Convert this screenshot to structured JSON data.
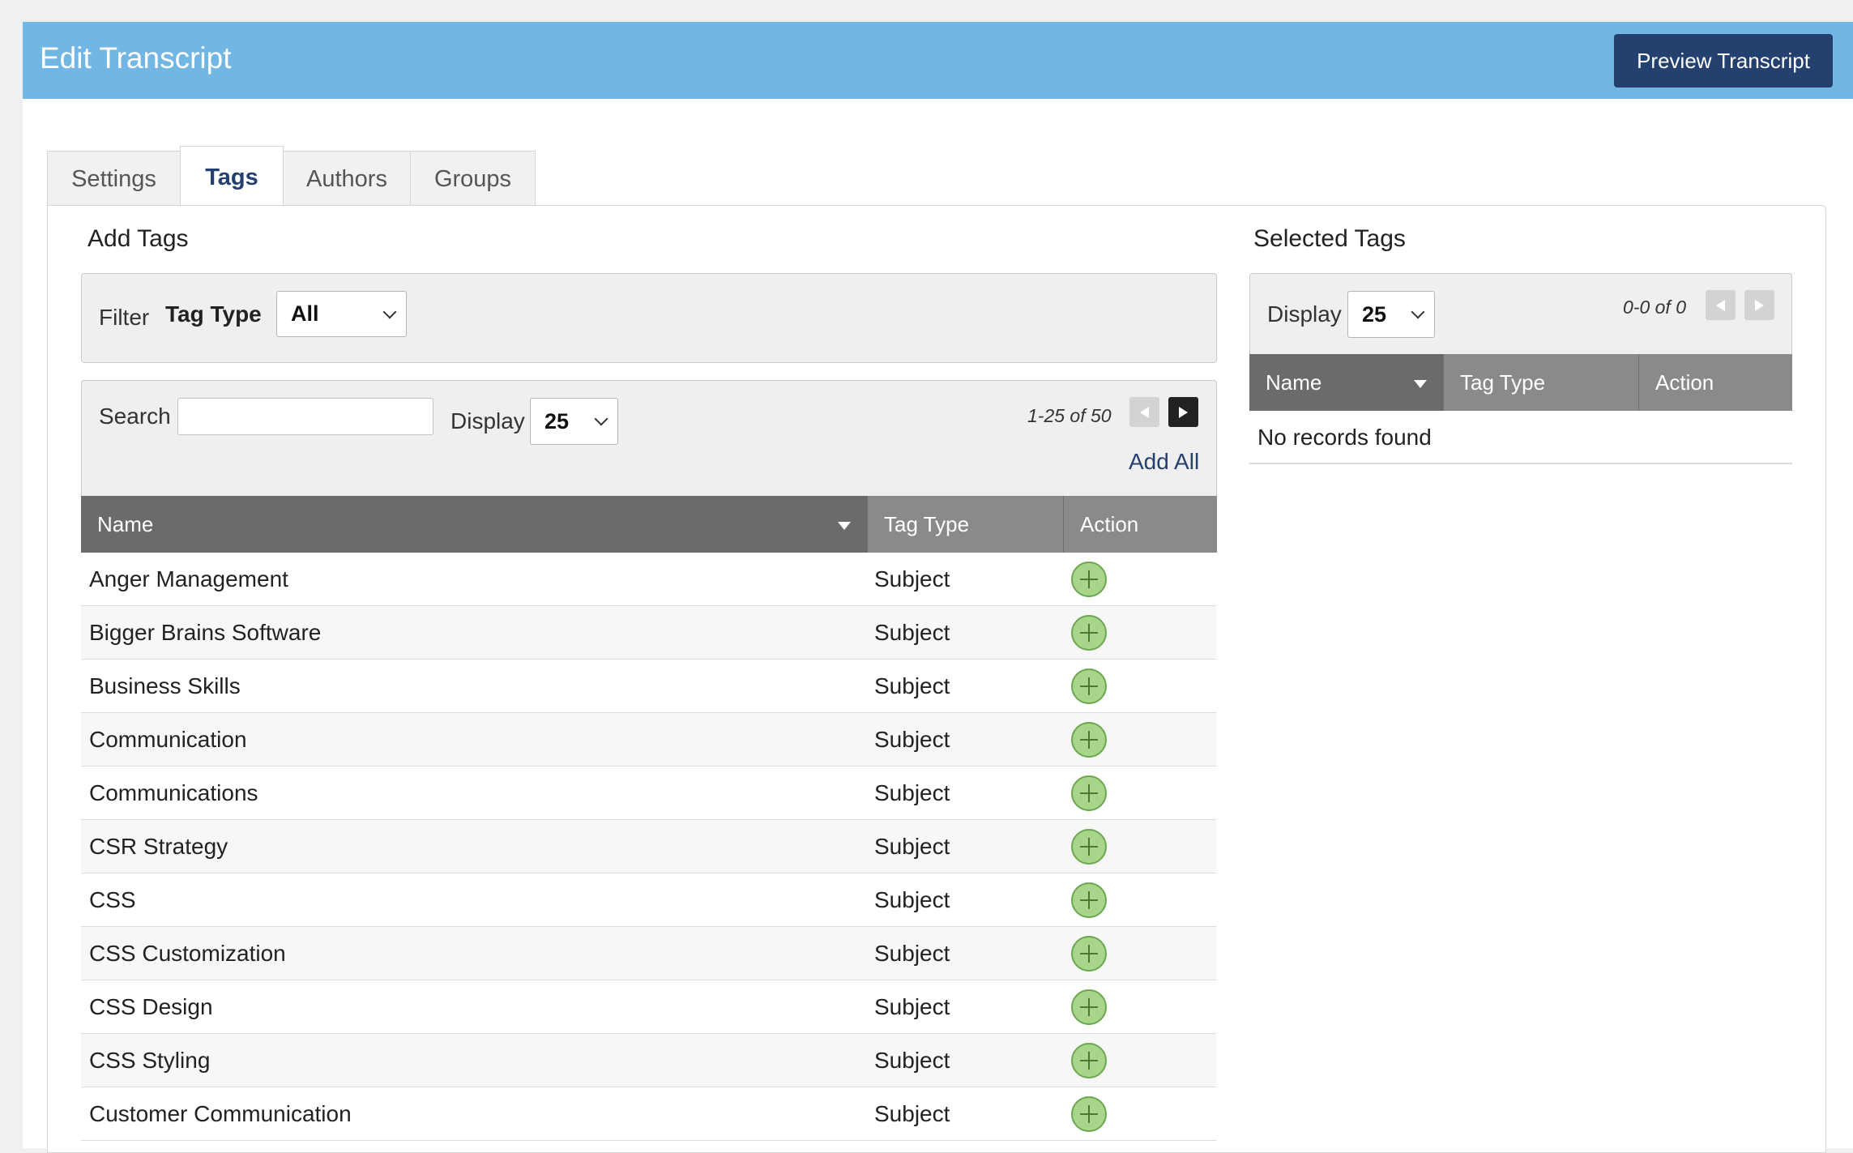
{
  "header": {
    "title": "Edit Transcript",
    "preview_label": "Preview Transcript"
  },
  "tabs": [
    {
      "label": "Settings",
      "active": false
    },
    {
      "label": "Tags",
      "active": true
    },
    {
      "label": "Authors",
      "active": false
    },
    {
      "label": "Groups",
      "active": false
    }
  ],
  "add_tags": {
    "title": "Add Tags",
    "filter": {
      "label": "Filter",
      "tag_type_label": "Tag Type",
      "tag_type_value": "All"
    },
    "search": {
      "label": "Search",
      "value": "",
      "placeholder": ""
    },
    "display": {
      "label": "Display",
      "value": "25"
    },
    "pager": {
      "text": "1-25 of 50"
    },
    "add_all_label": "Add All",
    "columns": {
      "name": "Name",
      "tag_type": "Tag Type",
      "action": "Action"
    },
    "rows": [
      {
        "name": "Anger Management",
        "tag_type": "Subject"
      },
      {
        "name": "Bigger Brains Software",
        "tag_type": "Subject"
      },
      {
        "name": "Business Skills",
        "tag_type": "Subject"
      },
      {
        "name": "Communication",
        "tag_type": "Subject"
      },
      {
        "name": "Communications",
        "tag_type": "Subject"
      },
      {
        "name": "CSR Strategy",
        "tag_type": "Subject"
      },
      {
        "name": "CSS",
        "tag_type": "Subject"
      },
      {
        "name": "CSS Customization",
        "tag_type": "Subject"
      },
      {
        "name": "CSS Design",
        "tag_type": "Subject"
      },
      {
        "name": "CSS Styling",
        "tag_type": "Subject"
      },
      {
        "name": "Customer Communication",
        "tag_type": "Subject"
      }
    ]
  },
  "selected_tags": {
    "title": "Selected Tags",
    "display": {
      "label": "Display",
      "value": "25"
    },
    "pager": {
      "text": "0-0 of 0"
    },
    "columns": {
      "name": "Name",
      "tag_type": "Tag Type",
      "action": "Action"
    },
    "empty_text": "No records found"
  },
  "colors": {
    "header_bg": "#72b6e3",
    "primary_button": "#23406e",
    "table_header_sorted": "#6b6b6b",
    "table_header": "#8a8a8a",
    "add_icon": "#a9d58b"
  },
  "icons": {
    "add": "plus-circle-icon",
    "sort": "sort-down-icon",
    "prev": "prev-page-icon",
    "next": "next-page-icon",
    "select": "chevron-down-icon"
  }
}
